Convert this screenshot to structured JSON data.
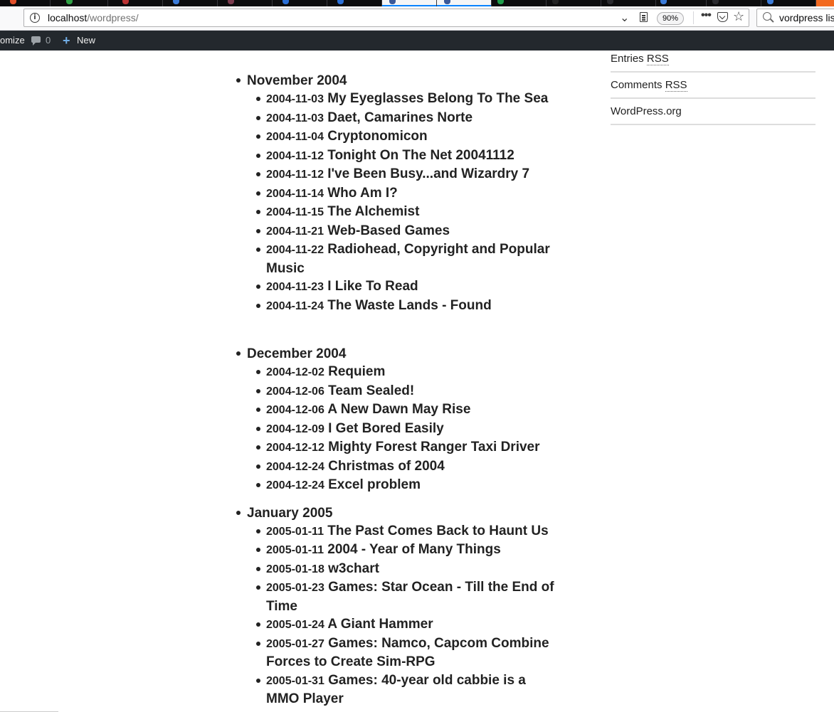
{
  "browser": {
    "url_host": "localhost",
    "url_path": "/wordpress/",
    "zoom": "90%",
    "search_text": "vordpress list"
  },
  "admin_bar": {
    "customize_label": "omize",
    "comments_count": "0",
    "new_label": "New"
  },
  "archive": [
    {
      "month": "November 2004",
      "posts": [
        {
          "date": "2004-11-03",
          "title": "My Eyeglasses Belong To The Sea"
        },
        {
          "date": "2004-11-03",
          "title": "Daet, Camarines Norte"
        },
        {
          "date": "2004-11-04",
          "title": "Cryptonomicon"
        },
        {
          "date": "2004-11-12",
          "title": "Tonight On The Net 20041112"
        },
        {
          "date": "2004-11-12",
          "title": "I've Been Busy...and Wizardry 7"
        },
        {
          "date": "2004-11-14",
          "title": "Who Am I?"
        },
        {
          "date": "2004-11-15",
          "title": "The Alchemist"
        },
        {
          "date": "2004-11-21",
          "title": "Web-Based Games"
        },
        {
          "date": "2004-11-22",
          "title": "Radiohead, Copyright and Popular Music"
        },
        {
          "date": "2004-11-23",
          "title": "I Like To Read"
        },
        {
          "date": "2004-11-24",
          "title": "The Waste Lands - Found"
        }
      ]
    },
    {
      "month": "December 2004",
      "posts": [
        {
          "date": "2004-12-02",
          "title": "Requiem"
        },
        {
          "date": "2004-12-06",
          "title": "Team Sealed!"
        },
        {
          "date": "2004-12-06",
          "title": "A New Dawn May Rise"
        },
        {
          "date": "2004-12-09",
          "title": "I Get Bored Easily"
        },
        {
          "date": "2004-12-12",
          "title": "Mighty Forest Ranger Taxi Driver"
        },
        {
          "date": "2004-12-24",
          "title": "Christmas of 2004"
        },
        {
          "date": "2004-12-24",
          "title": "Excel problem"
        }
      ]
    },
    {
      "month": "January 2005",
      "posts": [
        {
          "date": "2005-01-11",
          "title": "The Past Comes Back to Haunt Us"
        },
        {
          "date": "2005-01-11",
          "title": "2004 - Year of Many Things"
        },
        {
          "date": "2005-01-18",
          "title": "w3chart"
        },
        {
          "date": "2005-01-23",
          "title": "Games: Star Ocean - Till the End of Time"
        },
        {
          "date": "2005-01-24",
          "title": "A Giant Hammer"
        },
        {
          "date": "2005-01-27",
          "title": "Games: Namco, Capcom Combine Forces to Create Sim-RPG"
        },
        {
          "date": "2005-01-31",
          "title": "Games: 40-year old cabbie is a MMO Player"
        }
      ]
    }
  ],
  "sidebar": {
    "entries_prefix": "Entries",
    "comments_prefix": "Comments",
    "rss_abbr": "RSS",
    "wordpress_org": "WordPress.org"
  }
}
